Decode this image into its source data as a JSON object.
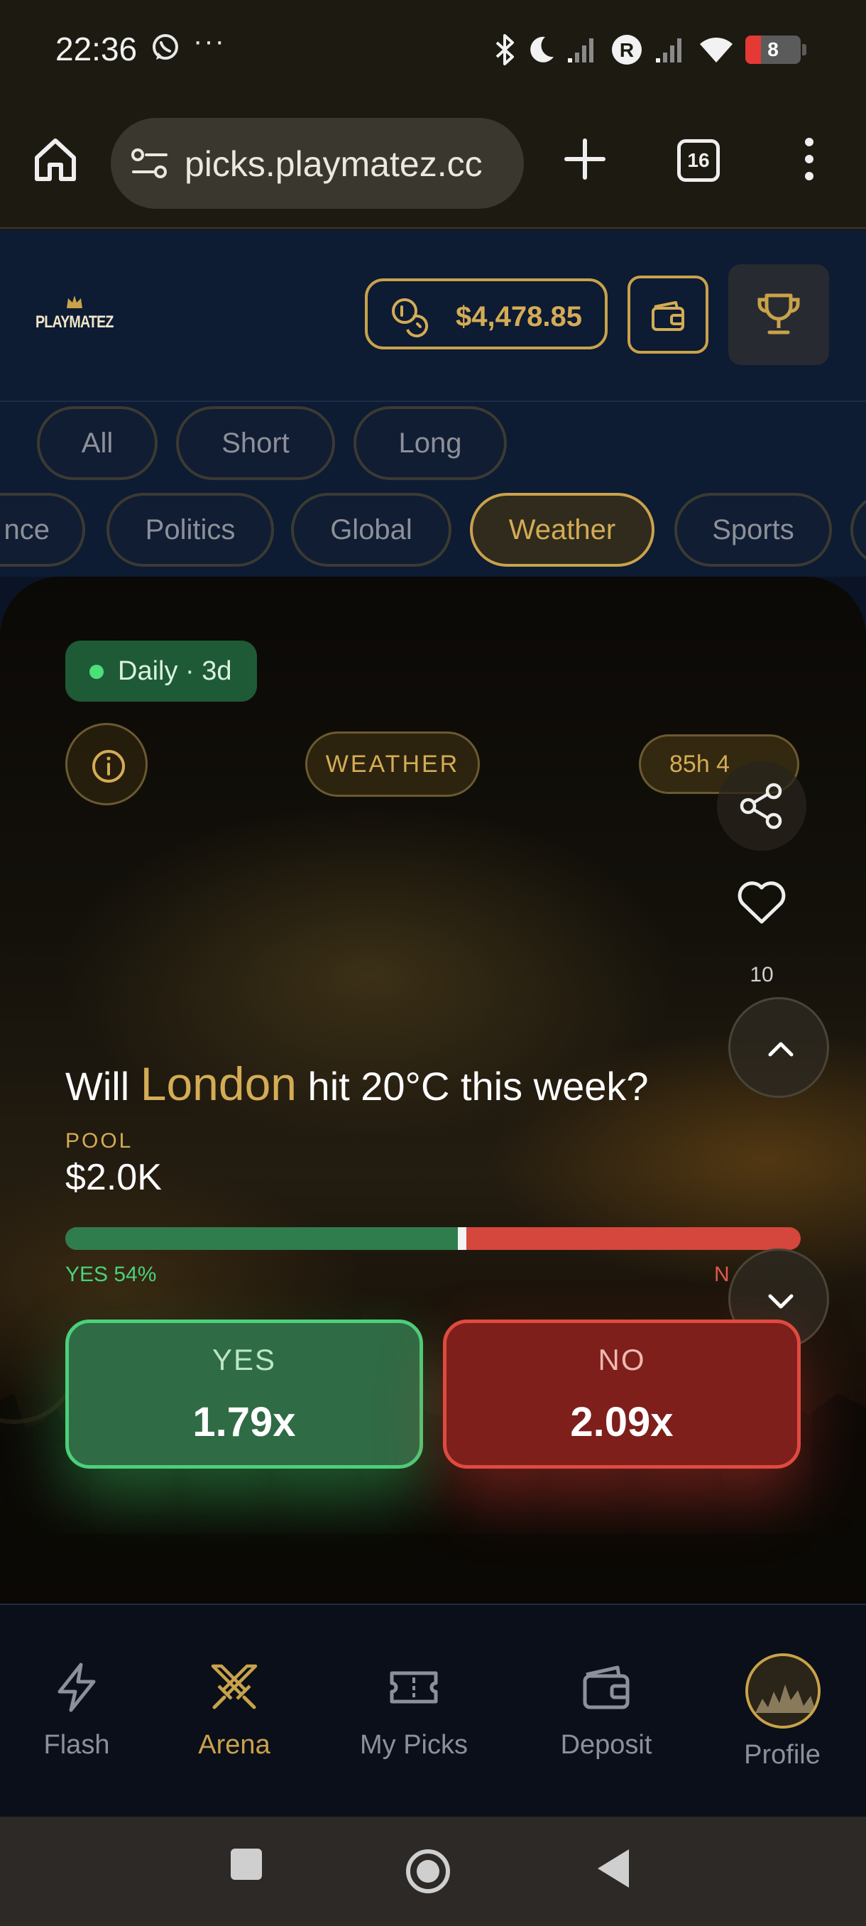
{
  "status_bar": {
    "time": "22:36",
    "overflow": "···",
    "battery": "8",
    "icons": [
      "whatsapp-icon",
      "bluetooth-icon",
      "do-not-disturb-moon-icon",
      "signal-icon",
      "roaming-r-icon",
      "signal-icon",
      "wifi-icon",
      "battery-icon"
    ]
  },
  "browser": {
    "url": "picks.playmatez.cc",
    "tab_count": "16"
  },
  "header": {
    "logo_text": "PLAYMATEZ",
    "balance": "$4,478.85"
  },
  "filters": {
    "durations": [
      "All",
      "Short",
      "Long"
    ],
    "categories": [
      "nce",
      "Politics",
      "Global",
      "Weather",
      "Sports"
    ],
    "active_category": "Weather"
  },
  "market": {
    "frequency_badge": "Daily · 3d",
    "category": "WEATHER",
    "time_left": "85h 4",
    "like_count": "10",
    "question_prefix": "Will ",
    "question_highlight": "London",
    "question_suffix": " hit 20°C this week?",
    "pool_label": "POOL",
    "pool_value": "$2.0K",
    "yes_percent_label": "YES 54%",
    "no_percent_label": "N",
    "yes_share": 0.54,
    "yes_label": "YES",
    "yes_odds": "1.79x",
    "no_label": "NO",
    "no_odds": "2.09x"
  },
  "bottom_nav": {
    "items": [
      {
        "label": "Flash",
        "icon": "lightning-icon"
      },
      {
        "label": "Arena",
        "icon": "crossed-swords-icon"
      },
      {
        "label": "My Picks",
        "icon": "ticket-icon"
      },
      {
        "label": "Deposit",
        "icon": "wallet-icon"
      },
      {
        "label": "Profile",
        "icon": "avatar"
      }
    ],
    "active": "Arena"
  },
  "colors": {
    "accent_gold": "#c9a24a",
    "header_bg": "#0d1b33",
    "yes_green": "#4cd07a",
    "no_red": "#e04a3e"
  }
}
